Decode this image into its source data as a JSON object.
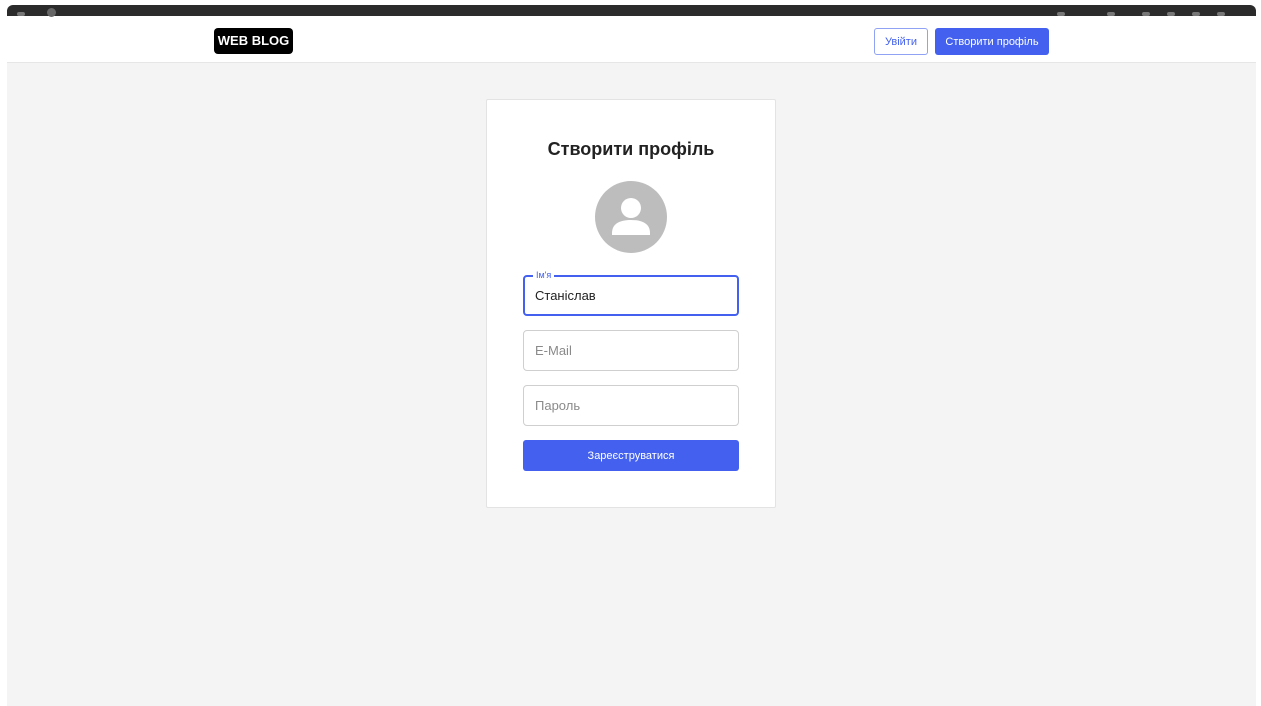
{
  "header": {
    "logo": "WEB BLOG",
    "login_label": "Увійти",
    "signup_label": "Створити профіль"
  },
  "form": {
    "title": "Створити профіль",
    "avatar_icon": "user-avatar-icon",
    "name": {
      "label": "Ім'я",
      "value": "Станіслав"
    },
    "email": {
      "placeholder": "E-Mail",
      "value": ""
    },
    "password": {
      "placeholder": "Пароль",
      "value": ""
    },
    "submit_label": "Зареєструватися"
  },
  "colors": {
    "accent": "#4361ee",
    "background": "#f4f4f4",
    "logo_bg": "#000000",
    "avatar_bg": "#bdbdbd"
  }
}
